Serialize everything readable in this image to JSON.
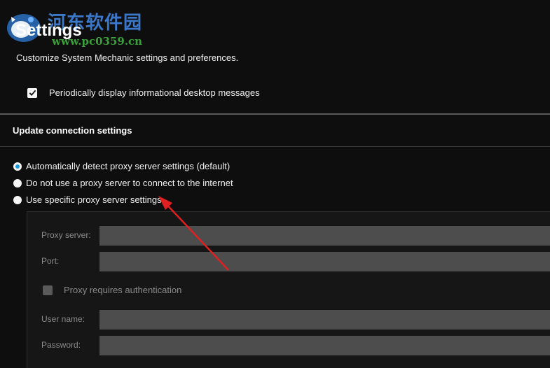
{
  "watermark": {
    "title": "河东软件园",
    "url": "www.pc0359.cn"
  },
  "header": {
    "title": "Settings",
    "subtitle": "Customize System Mechanic settings and preferences."
  },
  "desktop_messages": {
    "label": "Periodically display informational desktop messages",
    "checked": true
  },
  "update_connection": {
    "title": "Update connection settings",
    "options": [
      {
        "label": "Automatically detect proxy server settings (default)",
        "selected": true
      },
      {
        "label": "Do not use a proxy server to connect to the internet",
        "selected": false
      },
      {
        "label": "Use specific proxy server settings",
        "selected": false
      }
    ]
  },
  "proxy": {
    "server_label": "Proxy server:",
    "server_value": "",
    "port_label": "Port:",
    "port_value": "",
    "auth_label": "Proxy requires authentication",
    "auth_checked": false,
    "username_label": "User name:",
    "username_value": "",
    "password_label": "Password:",
    "password_value": ""
  },
  "colors": {
    "background": "#0e0e0e",
    "radio_selected": "#1a9bd7",
    "annotation_arrow": "#e02020",
    "watermark_title": "#3b78c9",
    "watermark_url": "#3aa03a"
  }
}
